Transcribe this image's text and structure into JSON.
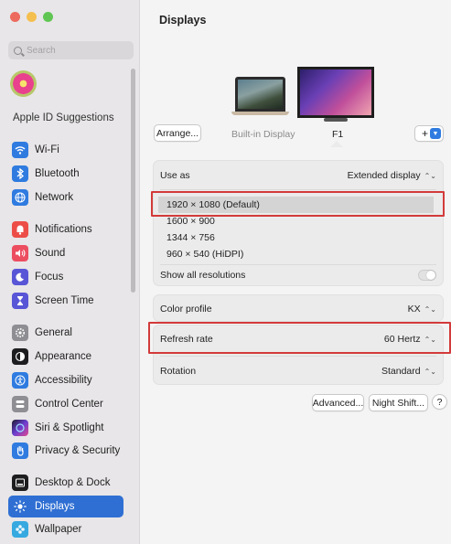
{
  "sidebar": {
    "search_placeholder": "Search",
    "apple_id_label": "Apple ID Suggestions",
    "items": [
      {
        "label": "Wi-Fi",
        "icon": "wifi-icon",
        "color": "#2f7be0"
      },
      {
        "label": "Bluetooth",
        "icon": "bluetooth-icon",
        "color": "#2f7be0"
      },
      {
        "label": "Network",
        "icon": "globe-icon",
        "color": "#2f7be0"
      },
      {
        "label": "Notifications",
        "icon": "bell-icon",
        "color": "#ec4e47"
      },
      {
        "label": "Sound",
        "icon": "speaker-icon",
        "color": "#ec4e60"
      },
      {
        "label": "Focus",
        "icon": "moon-icon",
        "color": "#5856d6"
      },
      {
        "label": "Screen Time",
        "icon": "hourglass-icon",
        "color": "#5856d6"
      },
      {
        "label": "General",
        "icon": "gear-icon",
        "color": "#8e8e93"
      },
      {
        "label": "Appearance",
        "icon": "appearance-icon",
        "color": "#1d1d1f"
      },
      {
        "label": "Accessibility",
        "icon": "accessibility-icon",
        "color": "#2f7be0"
      },
      {
        "label": "Control Center",
        "icon": "control-center-icon",
        "color": "#8e8e93"
      },
      {
        "label": "Siri & Spotlight",
        "icon": "siri-icon",
        "color": "#6b3fd0"
      },
      {
        "label": "Privacy & Security",
        "icon": "hand-icon",
        "color": "#2f7be0"
      },
      {
        "label": "Desktop & Dock",
        "icon": "dock-icon",
        "color": "#1d1d1f"
      },
      {
        "label": "Displays",
        "icon": "sun-icon",
        "color": "#2f7be0"
      },
      {
        "label": "Wallpaper",
        "icon": "wallpaper-icon",
        "color": "#36a9e0"
      }
    ]
  },
  "main": {
    "title": "Displays",
    "arrange_label": "Arrange...",
    "builtin_label": "Built-in Display",
    "f1_label": "F1",
    "add_label": "+",
    "use_as_label": "Use as",
    "use_as_value": "Extended display",
    "resolutions": [
      "1920 × 1080 (Default)",
      "1600 × 900",
      "1344 × 756",
      "960 × 540 (HiDPI)"
    ],
    "show_all_label": "Show all resolutions",
    "color_profile_label": "Color profile",
    "color_profile_value": "KX",
    "refresh_rate_label": "Refresh rate",
    "refresh_rate_value": "60 Hertz",
    "rotation_label": "Rotation",
    "rotation_value": "Standard",
    "advanced_label": "Advanced...",
    "night_shift_label": "Night Shift...",
    "help_label": "?"
  }
}
